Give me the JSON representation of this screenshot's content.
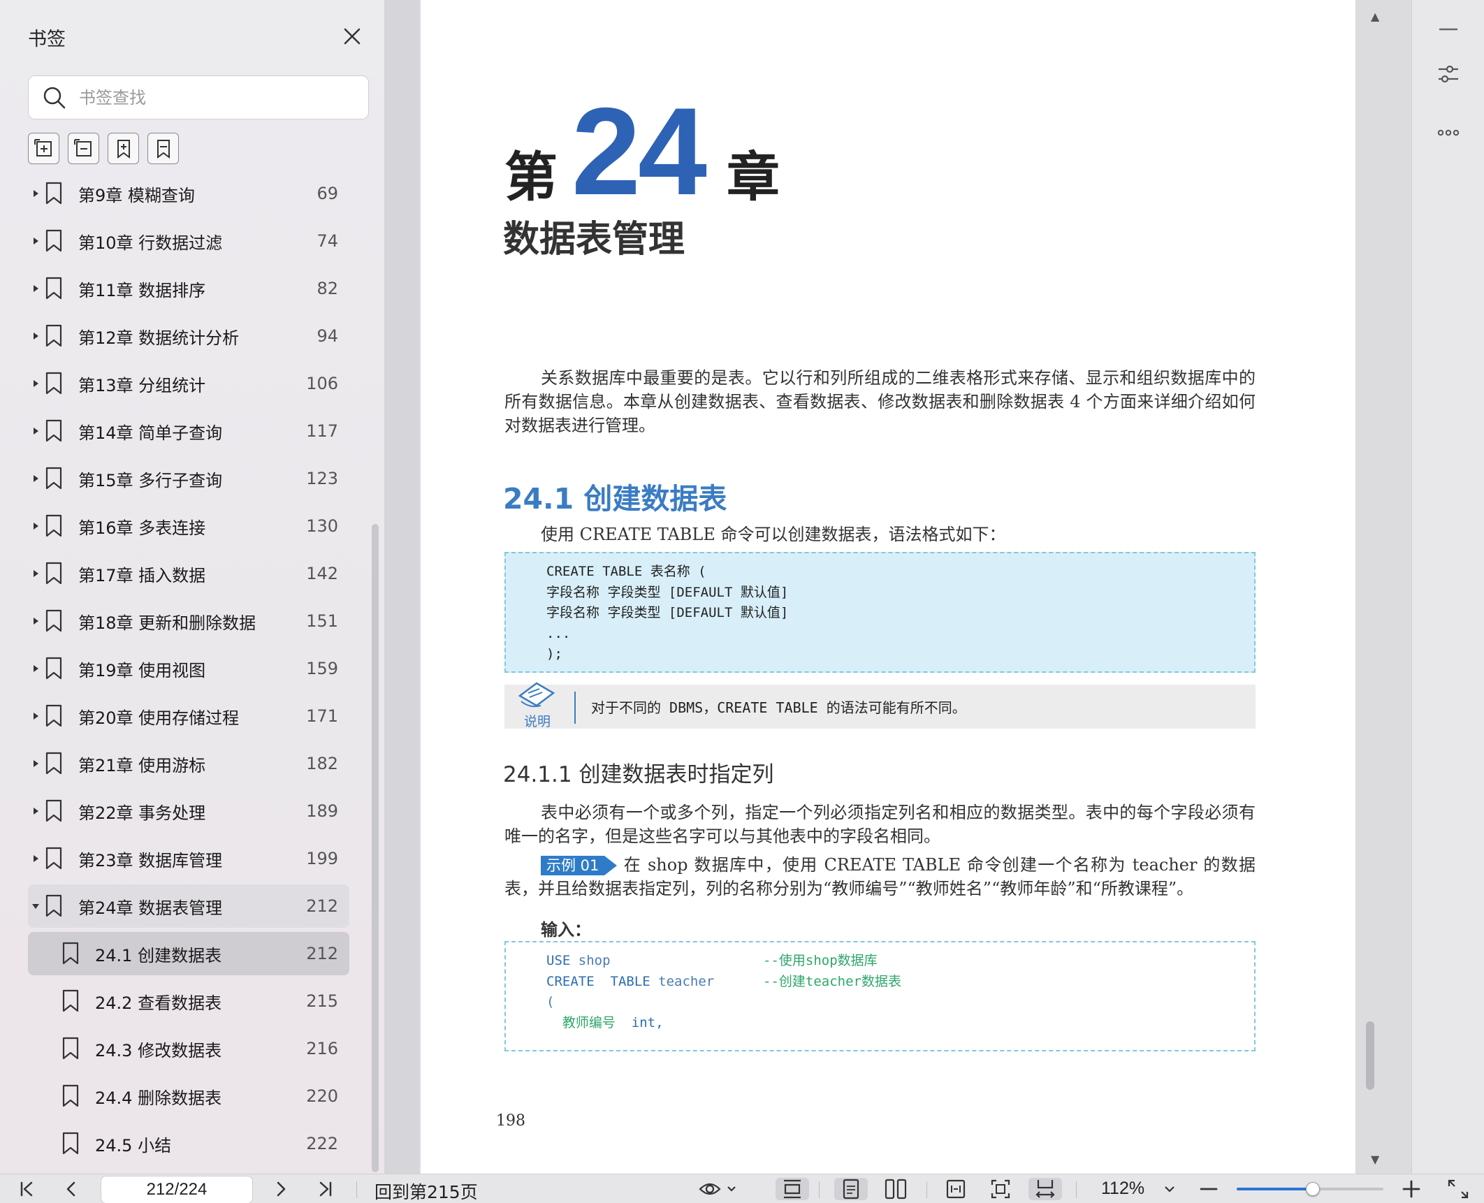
{
  "sidebar": {
    "title": "书签",
    "search_placeholder": "书签查找",
    "tools": [
      "expand-all-icon",
      "collapse-all-icon",
      "add-bookmark-icon",
      "bookmark-icon"
    ],
    "items": [
      {
        "label": "第9章 模糊查询",
        "page": "69",
        "level": 1,
        "state": "collapsed"
      },
      {
        "label": "第10章 行数据过滤",
        "page": "74",
        "level": 1,
        "state": "collapsed"
      },
      {
        "label": "第11章 数据排序",
        "page": "82",
        "level": 1,
        "state": "collapsed"
      },
      {
        "label": "第12章 数据统计分析",
        "page": "94",
        "level": 1,
        "state": "collapsed"
      },
      {
        "label": "第13章 分组统计",
        "page": "106",
        "level": 1,
        "state": "collapsed"
      },
      {
        "label": "第14章 简单子查询",
        "page": "117",
        "level": 1,
        "state": "collapsed"
      },
      {
        "label": "第15章 多行子查询",
        "page": "123",
        "level": 1,
        "state": "collapsed"
      },
      {
        "label": "第16章 多表连接",
        "page": "130",
        "level": 1,
        "state": "collapsed"
      },
      {
        "label": "第17章 插入数据",
        "page": "142",
        "level": 1,
        "state": "collapsed"
      },
      {
        "label": "第18章 更新和删除数据",
        "page": "151",
        "level": 1,
        "state": "collapsed"
      },
      {
        "label": "第19章 使用视图",
        "page": "159",
        "level": 1,
        "state": "collapsed"
      },
      {
        "label": "第20章 使用存储过程",
        "page": "171",
        "level": 1,
        "state": "collapsed"
      },
      {
        "label": "第21章 使用游标",
        "page": "182",
        "level": 1,
        "state": "collapsed"
      },
      {
        "label": "第22章 事务处理",
        "page": "189",
        "level": 1,
        "state": "collapsed"
      },
      {
        "label": "第23章 数据库管理",
        "page": "199",
        "level": 1,
        "state": "collapsed"
      },
      {
        "label": "第24章 数据表管理",
        "page": "212",
        "level": 1,
        "state": "expanded"
      },
      {
        "label": "24.1 创建数据表",
        "page": "212",
        "level": 2,
        "state": "selected"
      },
      {
        "label": "24.2 查看数据表",
        "page": "215",
        "level": 2,
        "state": "none"
      },
      {
        "label": "24.3 修改数据表",
        "page": "216",
        "level": 2,
        "state": "none"
      },
      {
        "label": "24.4 删除数据表",
        "page": "220",
        "level": 2,
        "state": "none"
      },
      {
        "label": "24.5 小结",
        "page": "222",
        "level": 2,
        "state": "none"
      }
    ]
  },
  "document": {
    "chapter_prefix": "第",
    "chapter_number": "24",
    "chapter_suffix": "章",
    "chapter_title": "数据表管理",
    "intro": "关系数据库中最重要的是表。它以行和列所组成的二维表格形式来存储、显示和组织数据库中的所有数据信息。本章从创建数据表、查看数据表、修改数据表和删除数据表 4 个方面来详细介绍如何对数据表进行管理。",
    "section_heading": "24.1  创建数据表",
    "section_intro": "使用 CREATE TABLE 命令可以创建数据表，语法格式如下：",
    "syntax_code": "CREATE TABLE 表名称 (\n字段名称 字段类型 [DEFAULT 默认值]\n字段名称 字段类型 [DEFAULT 默认值]\n...\n);",
    "note_label": "说明",
    "note_text": "对于不同的 DBMS，CREATE TABLE 的语法可能有所不同。",
    "subsection_heading": "24.1.1  创建数据表时指定列",
    "subsection_para": "表中必须有一个或多个列，指定一个列必须指定列名和相应的数据类型。表中的每个字段必须有唯一的名字，但是这些名字可以与其他表中的字段名相同。",
    "example_badge": "示例 01",
    "example_text": "在 shop 数据库中，使用 CREATE TABLE 命令创建一个名称为 teacher 的数据表，并且给数据表指定列，列的名称分别为“教师编号”“教师姓名”“教师年龄”和“所教课程”。",
    "input_label": "输入：",
    "code": {
      "l1_kw": "USE",
      "l1_id": " shop",
      "l1_comment": "--使用shop数据库",
      "l2_kw": "CREATE  TABLE",
      "l2_id": " teacher",
      "l2_comment": "--创建teacher数据表",
      "l3": "(",
      "l4_col": "  教师编号",
      "l4_type": "  int,"
    },
    "page_number": "198"
  },
  "bottom_bar": {
    "page_input": "212/224",
    "back_link": "回到第215页",
    "zoom": "112%",
    "zoom_slider_fraction": 0.52
  },
  "right_toolbar": {
    "icons": [
      "minimize-icon",
      "settings-sliders-icon",
      "more-icon"
    ]
  },
  "colors": {
    "accent": "#2e62b5",
    "heading_blue": "#3a7cc4",
    "code_bg": "#d8eff9",
    "comment_green": "#2fa66a"
  }
}
